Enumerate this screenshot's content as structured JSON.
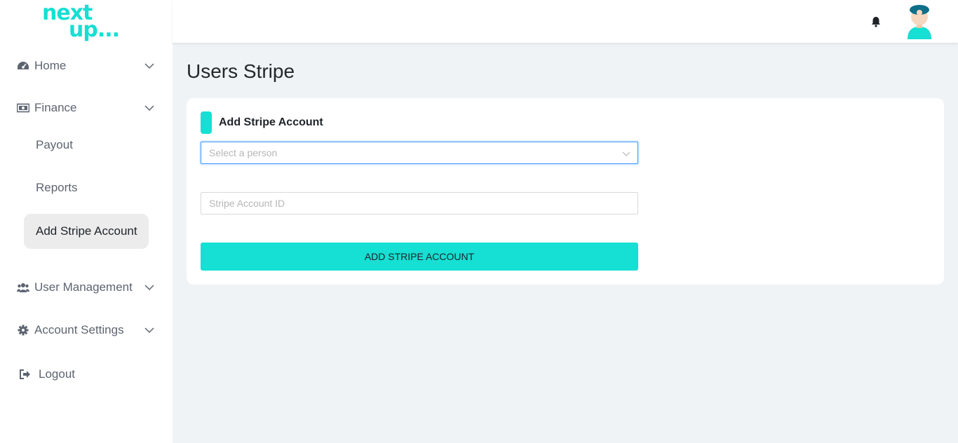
{
  "brand": {
    "logo_line1": "next",
    "logo_line2": "up..."
  },
  "header": {
    "notifications_icon": "bell-icon",
    "avatar_icon": "user-avatar"
  },
  "sidebar": {
    "home": {
      "label": "Home",
      "icon": "dashboard-icon"
    },
    "finance": {
      "label": "Finance",
      "icon": "money-icon",
      "children": [
        "Payout",
        "Reports",
        "Add Stripe Account"
      ],
      "active_child": "Add Stripe Account"
    },
    "user_management": {
      "label": "User Management",
      "icon": "users-icon"
    },
    "account_settings": {
      "label": "Account Settings",
      "icon": "gear-icon"
    },
    "logout": {
      "label": "Logout",
      "icon": "logout-icon"
    }
  },
  "page": {
    "title": "Users Stripe"
  },
  "form": {
    "title": "Add Stripe Account",
    "person_select_placeholder": "Select a person",
    "account_id_placeholder": "Stripe Account ID",
    "account_id_value": "",
    "submit_label": "ADD STRIPE ACCOUNT"
  },
  "colors": {
    "accent": "#16dfd3",
    "background": "#f0f3f6",
    "focus_border": "#4096ff"
  }
}
